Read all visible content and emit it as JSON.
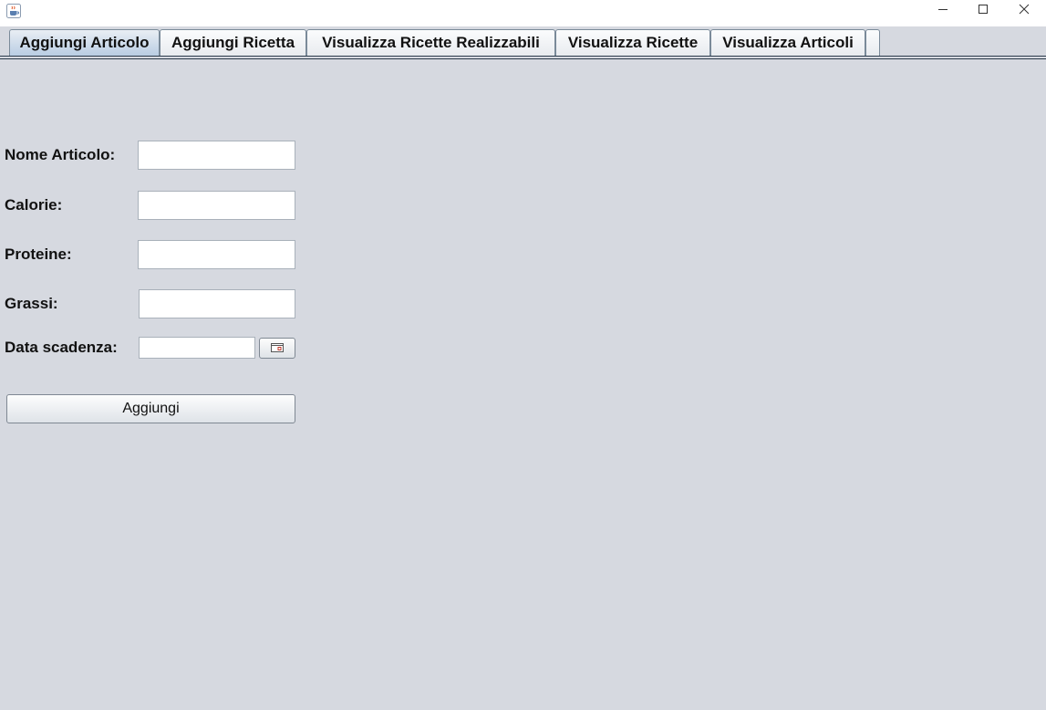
{
  "window": {
    "app_icon": "java-coffee-icon",
    "controls": {
      "minimize_icon": "minimize-icon",
      "maximize_icon": "maximize-icon",
      "close_icon": "close-icon"
    }
  },
  "tabs": [
    {
      "label": "Aggiungi Articolo",
      "selected": true
    },
    {
      "label": "Aggiungi Ricetta",
      "selected": false
    },
    {
      "label": "Visualizza Ricette Realizzabili",
      "selected": false
    },
    {
      "label": "Visualizza Ricette",
      "selected": false
    },
    {
      "label": "Visualizza Articoli",
      "selected": false
    },
    {
      "label": "",
      "selected": false
    }
  ],
  "form": {
    "nome_label": "Nome Articolo:",
    "nome_value": "",
    "calorie_label": "Calorie:",
    "calorie_value": "",
    "proteine_label": "Proteine:",
    "proteine_value": "",
    "grassi_label": "Grassi:",
    "grassi_value": "",
    "data_label": "Data scadenza:",
    "data_value": "",
    "calendar_icon": "calendar-icon",
    "add_label": "Aggiungi"
  },
  "colors": {
    "background": "#d6d9e0",
    "tab_selected": "#b9cde3",
    "calendar_accent": "#c0392b"
  }
}
